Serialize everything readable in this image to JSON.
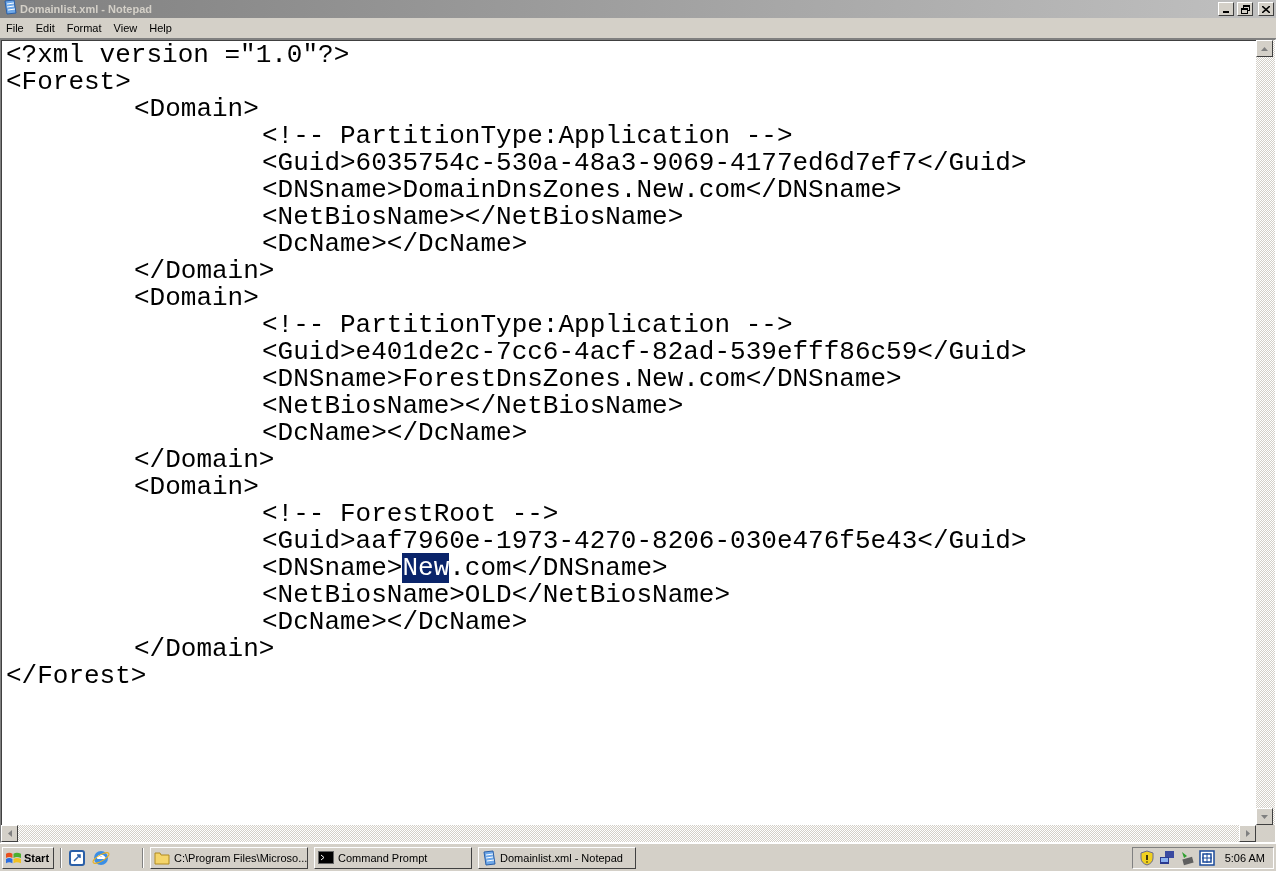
{
  "window": {
    "title": "Domainlist.xml - Notepad"
  },
  "menu": [
    "File",
    "Edit",
    "Format",
    "View",
    "Help"
  ],
  "document": {
    "lines": [
      {
        "text": "<?xml version =\"1.0\"?>"
      },
      {
        "text": "<Forest>",
        "children": [
          {
            "text": "<Domain>",
            "children": [
              {
                "text": "<!-- PartitionType:Application -->"
              },
              {
                "text": "<Guid>6035754c-530a-48a3-9069-4177ed6d7ef7</Guid>"
              },
              {
                "text": "<DNSname>DomainDnsZones.New.com</DNSname>"
              },
              {
                "text": "<NetBiosName></NetBiosName>"
              },
              {
                "text": "<DcName></DcName>"
              }
            ]
          },
          {
            "text": "</Domain>"
          },
          {
            "text": "<Domain>",
            "children": [
              {
                "text": "<!-- PartitionType:Application -->"
              },
              {
                "text": "<Guid>e401de2c-7cc6-4acf-82ad-539efff86c59</Guid>"
              },
              {
                "text": "<DNSname>ForestDnsZones.New.com</DNSname>"
              },
              {
                "text": "<NetBiosName></NetBiosName>"
              },
              {
                "text": "<DcName></DcName>"
              }
            ]
          },
          {
            "text": "</Domain>"
          },
          {
            "text": "<Domain>",
            "children": [
              {
                "text": "<!-- ForestRoot -->"
              },
              {
                "text": "<Guid>aaf7960e-1973-4270-8206-030e476f5e43</Guid>"
              },
              {
                "parts": [
                  {
                    "text": "<DNSname>",
                    "selected": false
                  },
                  {
                    "text": "New",
                    "selected": true
                  },
                  {
                    "text": ".com</DNSname>",
                    "selected": false
                  }
                ]
              },
              {
                "text": "<NetBiosName>OLD</NetBiosName>"
              },
              {
                "text": "<DcName></DcName>"
              }
            ]
          },
          {
            "text": "</Domain>"
          }
        ]
      },
      {
        "text": "</Forest>"
      }
    ]
  },
  "taskbar": {
    "start": "Start",
    "tasks": [
      {
        "label": "C:\\Program Files\\Microso...",
        "kind": "folder",
        "selected": false
      },
      {
        "label": "Command Prompt",
        "kind": "console",
        "selected": false
      },
      {
        "label": "Domainlist.xml - Notepad",
        "kind": "notepad",
        "selected": false
      }
    ],
    "clock": "5:06 AM"
  }
}
